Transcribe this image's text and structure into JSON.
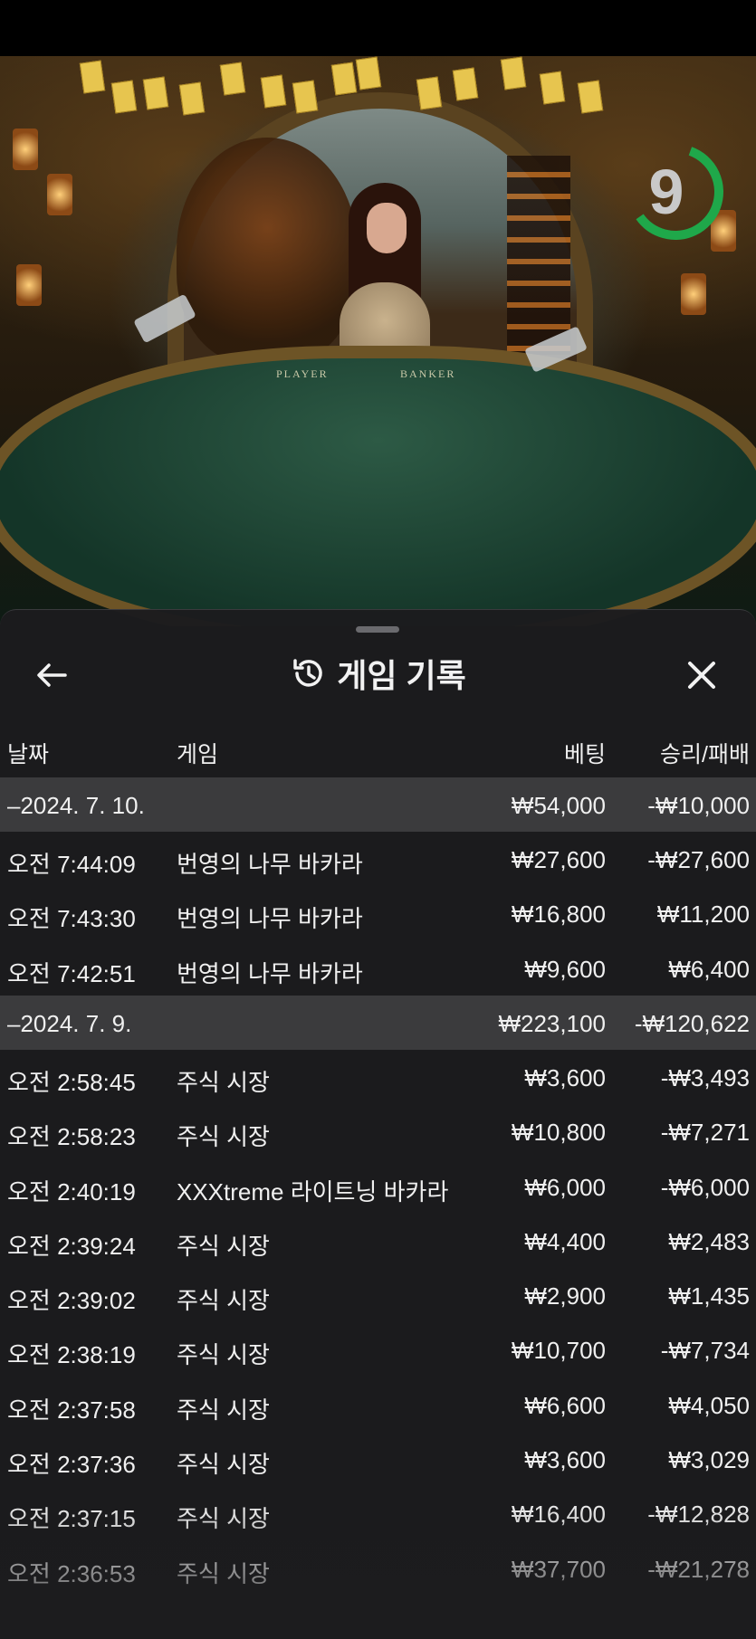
{
  "panel": {
    "title": "게임 기록",
    "columns": {
      "date": "날짜",
      "game": "게임",
      "bet": "베팅",
      "result": "승리/패배"
    }
  },
  "video": {
    "timer": "9",
    "felt_player": "PLAYER",
    "felt_banker": "BANKER"
  },
  "groups": [
    {
      "date": "–2024. 7. 10.",
      "bet": "₩54,000",
      "result": "-₩10,000",
      "rows": [
        {
          "time": "오전 7:44:09",
          "game": "번영의 나무 바카라",
          "bet": "₩27,600",
          "result": "-₩27,600"
        },
        {
          "time": "오전 7:43:30",
          "game": "번영의 나무 바카라",
          "bet": "₩16,800",
          "result": "₩11,200"
        },
        {
          "time": "오전 7:42:51",
          "game": "번영의 나무 바카라",
          "bet": "₩9,600",
          "result": "₩6,400"
        }
      ]
    },
    {
      "date": "–2024. 7. 9.",
      "bet": "₩223,100",
      "result": "-₩120,622",
      "rows": [
        {
          "time": "오전 2:58:45",
          "game": "주식 시장",
          "bet": "₩3,600",
          "result": "-₩3,493"
        },
        {
          "time": "오전 2:58:23",
          "game": "주식 시장",
          "bet": "₩10,800",
          "result": "-₩7,271"
        },
        {
          "time": "오전 2:40:19",
          "game": "XXXtreme 라이트닝 바카라",
          "bet": "₩6,000",
          "result": "-₩6,000"
        },
        {
          "time": "오전 2:39:24",
          "game": "주식 시장",
          "bet": "₩4,400",
          "result": "₩2,483"
        },
        {
          "time": "오전 2:39:02",
          "game": "주식 시장",
          "bet": "₩2,900",
          "result": "₩1,435"
        },
        {
          "time": "오전 2:38:19",
          "game": "주식 시장",
          "bet": "₩10,700",
          "result": "-₩7,734"
        },
        {
          "time": "오전 2:37:58",
          "game": "주식 시장",
          "bet": "₩6,600",
          "result": "₩4,050"
        },
        {
          "time": "오전 2:37:36",
          "game": "주식 시장",
          "bet": "₩3,600",
          "result": "₩3,029"
        },
        {
          "time": "오전 2:37:15",
          "game": "주식 시장",
          "bet": "₩16,400",
          "result": "-₩12,828"
        },
        {
          "time": "오전 2:36:53",
          "game": "주식 시장",
          "bet": "₩37,700",
          "result": "-₩21,278"
        }
      ]
    }
  ],
  "icons": {
    "back": "arrow-left-icon",
    "history": "history-icon",
    "close": "close-icon"
  },
  "colors": {
    "panel_bg": "#1c1c1e",
    "group_row_bg": "#3b3b3d",
    "timer_ring": "#1fa84a"
  }
}
